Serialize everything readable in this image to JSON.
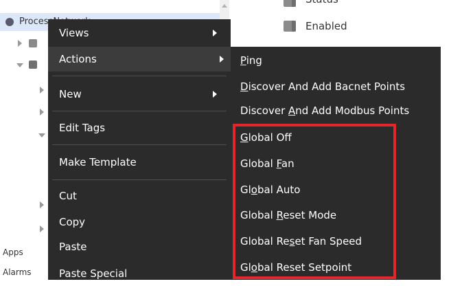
{
  "tree": {
    "root_label": "ProcessNetwork",
    "side_labels": {
      "apps": "Apps",
      "alarms": "Alarms"
    }
  },
  "right_panel": {
    "items": [
      {
        "label": "Status",
        "icon": "folder-icon"
      },
      {
        "label": "Enabled",
        "icon": "folder-icon"
      }
    ]
  },
  "context_menu": {
    "views": "Views",
    "actions": "Actions",
    "new": "New",
    "edit_tags": "Edit Tags",
    "make_template": "Make Template",
    "cut": "Cut",
    "copy": "Copy",
    "paste": "Paste",
    "paste_special": "Paste Special"
  },
  "actions_submenu": {
    "ping": {
      "pre": "",
      "key": "P",
      "post": "ing"
    },
    "discover_bacnet": {
      "pre": "",
      "key": "D",
      "post": "iscover And Add Bacnet Points"
    },
    "discover_modbus": {
      "pre": "Discover ",
      "key": "A",
      "post": "nd Add Modbus Points"
    },
    "global_off": {
      "pre": "",
      "key": "G",
      "post": "lobal Off"
    },
    "global_fan": {
      "pre": "Global ",
      "key": "F",
      "post": "an"
    },
    "global_auto": {
      "pre": "Gl",
      "key": "o",
      "post": "bal Auto"
    },
    "global_reset_mode": {
      "pre": "Global ",
      "key": "R",
      "post": "eset Mode"
    },
    "global_reset_fan_speed": {
      "pre": "Global Re",
      "key": "s",
      "post": "et Fan Speed"
    },
    "global_reset_setpoint": {
      "pre": "Gl",
      "key": "o",
      "post": "bal Reset Setpoint"
    }
  },
  "colors": {
    "menu_bg": "#2b2b2b",
    "highlight": "#e3262b",
    "selection": "#dce8fa"
  }
}
